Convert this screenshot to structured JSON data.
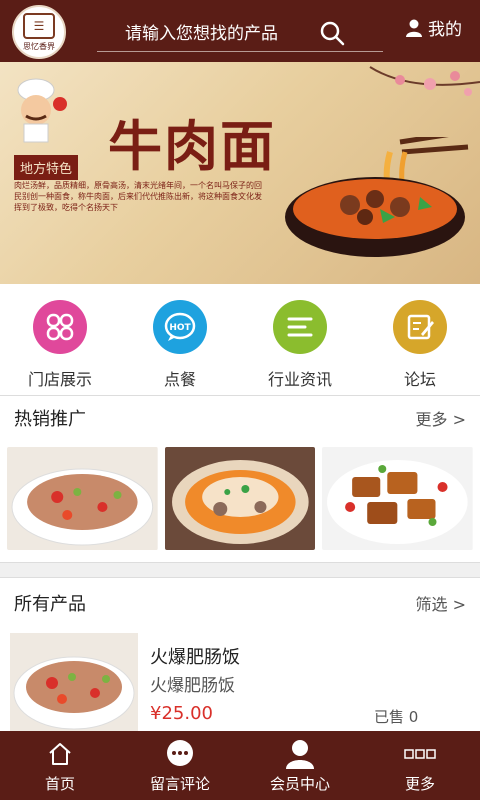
{
  "header": {
    "logo_text": "思忆香界",
    "search_placeholder": "请输入您想找的产品",
    "user_label": "我的"
  },
  "banner": {
    "title": "牛肉面",
    "tag": "地方特色",
    "desc": "肉烂汤鲜，品质精细，原骨高汤，清末光绪年间，一个名叫马保子的回民别创一种面食，称牛肉面，后来们代代推陈出新，将这种面食文化发挥到了极致，吃得个名扬天下"
  },
  "categories": [
    {
      "label": "门店展示",
      "icon": "grid-flower-icon",
      "color": "#e0489b"
    },
    {
      "label": "点餐",
      "icon": "hot-chat-icon",
      "color": "#1ea2df"
    },
    {
      "label": "行业资讯",
      "icon": "lines-icon",
      "color": "#8bbd2e"
    },
    {
      "label": "论坛",
      "icon": "edit-note-icon",
      "color": "#d6a62a"
    }
  ],
  "hot_section": {
    "title": "热销推广",
    "more": "更多 >"
  },
  "all_section": {
    "title": "所有产品",
    "filter": "筛选 >"
  },
  "product": {
    "name": "火爆肥肠饭",
    "subtitle": "火爆肥肠饭",
    "price": "¥25.00",
    "sold": "已售 0"
  },
  "footer": {
    "tabs": [
      {
        "label": "首页",
        "icon": "home-icon"
      },
      {
        "label": "留言评论",
        "icon": "chat-bubble-icon"
      },
      {
        "label": "会员中心",
        "icon": "user-icon"
      },
      {
        "label": "更多",
        "icon": "more-icon"
      }
    ]
  },
  "colors": {
    "brand": "#5a1d16",
    "price": "#d9302a"
  }
}
